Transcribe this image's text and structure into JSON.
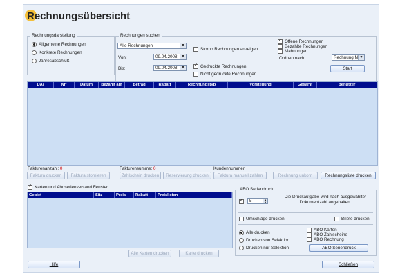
{
  "title": "Rechnungsübersicht",
  "rechnungsdarstellung": {
    "legend": "Rechnungsdarstellung",
    "options": [
      "Allgemeine Rechnungen",
      "Konkrete Rechnungen",
      "Jahresabschluß"
    ]
  },
  "rechnungen_suchen": {
    "legend": "Rechnungen suchen",
    "type_value": "Alle Rechnungen",
    "von_label": "Von:",
    "von_value": "09.04.2008",
    "bis_label": "Bis:",
    "bis_value": "09.04.2008",
    "storno_label": "Storno Rechnungen anzeigen",
    "gedruckte_label": "Gedruckte Rechnungen",
    "nicht_gedruckte_label": "Nicht gedruckte Rechnungen",
    "offene_label": "Offene Rechnungen",
    "bezahlte_label": "Bezahlte Rechnungen",
    "mahnungen_label": "Mahnungen",
    "ordnen_label": "Ordnen nach:",
    "ordnen_value": "Rechnung Nr.",
    "start_label": "Start"
  },
  "main_table": {
    "columns": [
      "DA/",
      "Nr/",
      "Datum",
      "Bezahlt am",
      "Betrag",
      "Rabatt",
      "Rechnungstyp",
      "Vorstellung",
      "Gesamt",
      "Benutzer"
    ]
  },
  "summary": {
    "fakturenanzahl_label": "Fakturenanzahl:",
    "fakturenanzahl_value": "0",
    "fakturensumme_label": "Fakturensumme:",
    "fakturensumme_value": "0",
    "kundennummer_label": "Kundennummer"
  },
  "action_buttons": [
    "Faktura drucken",
    "Faktura stornieren",
    "Zahlschein drucken",
    "Reservierung drucken",
    "Faktura manuell zahlen",
    "Rechnung unkorr.",
    "Rechnungsliste drucken"
  ],
  "karten": {
    "checkbox_label": "Karten und Aboserienversand Fenster",
    "columns": [
      "Gebiet",
      "Sitz",
      "Preis",
      "Rabatt",
      "Preislisten"
    ],
    "alle_karten_button": "Alle Karten drucken",
    "karte_button": "Karte drucken"
  },
  "abo": {
    "legend": "ABO Seriendruck",
    "count_value": "5",
    "info_text": "Die Druckaufgabe wird nach ausgewählter Dokumentzahl angehalten.",
    "umschlaege_label": "Umschläge drucken",
    "briefe_label": "Briefe drucken",
    "alle_drucken_label": "Alle drucken",
    "von_selektion_label": "Drucken von Selektion",
    "nur_selektion_label": "Drucken nur Selektion",
    "abo_karten_label": "ABO Karten",
    "abo_zahlscheine_label": "ABO Zahlscheine",
    "abo_rechnung_label": "ABO Rechnung",
    "seriendruck_button": "ABO Seriendruck"
  },
  "footer": {
    "hilfe_label": "Hilfe",
    "schliessen_label": "Schließen"
  }
}
